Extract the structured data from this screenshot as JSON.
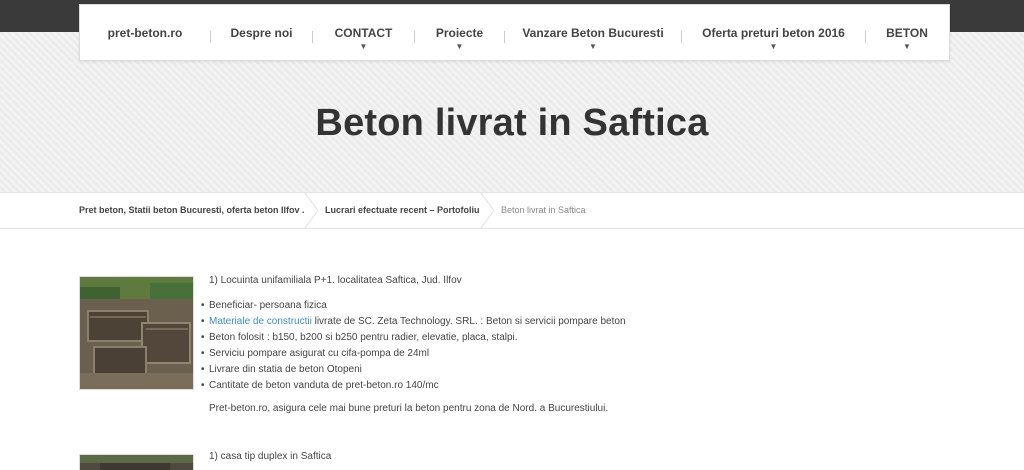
{
  "nav": {
    "items": [
      {
        "label": "pret-beton.ro",
        "has_dropdown": false
      },
      {
        "label": "Despre noi",
        "has_dropdown": false
      },
      {
        "label": "CONTACT",
        "has_dropdown": true
      },
      {
        "label": "Proiecte",
        "has_dropdown": true
      },
      {
        "label": "Vanzare Beton Bucuresti",
        "has_dropdown": true
      },
      {
        "label": "Oferta preturi beton 2016",
        "has_dropdown": true
      },
      {
        "label": "BETON",
        "has_dropdown": true
      }
    ]
  },
  "page": {
    "title": "Beton livrat in Saftica"
  },
  "breadcrumb": {
    "items": [
      "Pret beton, Statii beton Bucuresti, oferta beton Ilfov .",
      "Lucrari efectuate recent – Portofoliu",
      "Beton livrat in Saftica"
    ]
  },
  "content": {
    "project1": {
      "heading": "1) Locuinta unifamiliala P+1. localitatea Saftica, Jud. Ilfov",
      "bullets": {
        "b1": "Beneficiar- persoana fizica",
        "b2_link": "Materiale de constructii",
        "b2_rest": " livrate de SC. Zeta Technology. SRL. : Beton si servicii pompare beton",
        "b3": "Beton folosit : b150, b200 si b250 pentru radier, elevatie, placa, stalpi.",
        "b4": "Serviciu pompare asigurat cu cifa-pompa de 24ml",
        "b5": "Livrare din statia de beton Otopeni",
        "b6": "Cantitate de beton vanduta de pret-beton.ro 140/mc"
      },
      "footer": "Pret-beton.ro, asigura cele mai bune preturi la beton pentru zona de Nord. a Bucurestiului."
    },
    "project2": {
      "heading": "1) casa tip duplex in Saftica"
    }
  },
  "colors": {
    "link": "#3b8ec6",
    "topbar": "#3a3a3a",
    "hero_bg": "#ececec"
  }
}
